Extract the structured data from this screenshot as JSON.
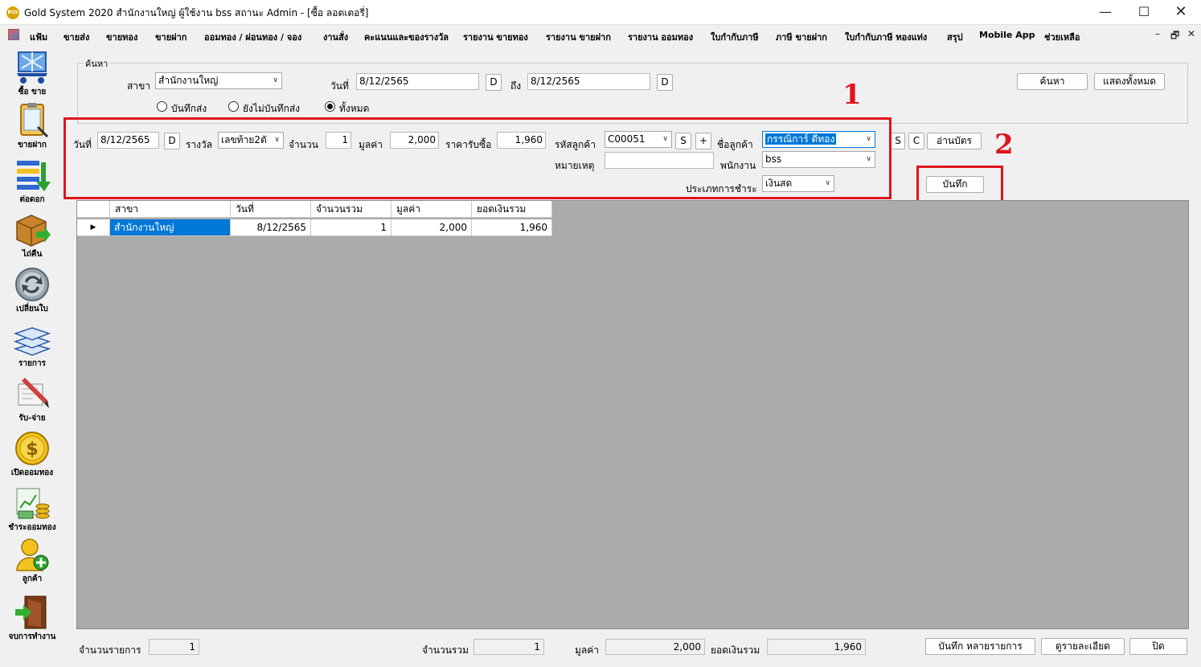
{
  "window": {
    "icon_text": "BSS",
    "title": "Gold System 2020  สำนักงานใหญ่ ผู้ใช้งาน bss สถานะ Admin - [ซื้อ ลอตเตอรี่]",
    "min": "—",
    "max": "☐",
    "close": "✕"
  },
  "menu": {
    "items": [
      "แฟ้ม",
      "ขายส่ง",
      "ขายทอง",
      "ขายฝาก",
      "ออมทอง / ผ่อนทอง / จอง",
      "งานสั่ง",
      "คะแนนและของรางวัล",
      "รายงาน ขายทอง",
      "รายงาน ขายฝาก",
      "รายงาน ออมทอง",
      "ใบกำกับภาษี",
      "ภาษี ขายฝาก",
      "ใบกำกับภาษี ทองแท่ง",
      "สรุป",
      "Mobile App",
      "ช่วยเหลือ"
    ],
    "mdi": [
      "–",
      "🗗",
      "✕"
    ]
  },
  "sidebar": {
    "items": [
      {
        "label": "ซื้อ ขาย",
        "icon": "cart-icon"
      },
      {
        "label": "ขายฝาก",
        "icon": "clipboard-icon"
      },
      {
        "label": "ต่อดอก",
        "icon": "arrows-icon"
      },
      {
        "label": "ไถ่คืน",
        "icon": "box-icon"
      },
      {
        "label": "เปลี่ยนใบ",
        "icon": "refresh-icon"
      },
      {
        "label": "รายการ",
        "icon": "layers-icon"
      },
      {
        "label": "รับ-จ่าย",
        "icon": "pen-icon"
      },
      {
        "label": "เปิดออมทอง",
        "icon": "coin-icon"
      },
      {
        "label": "ชำระออมทอง",
        "icon": "money-icon"
      },
      {
        "label": "ลูกค้า",
        "icon": "user-add-icon"
      },
      {
        "label": "จบการทำงาน",
        "icon": "exit-icon"
      }
    ]
  },
  "search": {
    "legend": "ค้นหา",
    "branch_label": "สาขา",
    "branch_value": "สำนักงานใหญ่",
    "date_label": "วันที่",
    "date_from": "8/12/2565",
    "d_button": "D",
    "to_label": "ถึง",
    "date_to": "8/12/2565",
    "search_button": "ค้นหา",
    "show_all_button": "แสดงทั้งหมด",
    "radio_saved": "บันทึกส่ง",
    "radio_unsaved": "ยังไม่บันทึกส่ง",
    "radio_all": "ทั้งหมด"
  },
  "form": {
    "date_label": "วันที่",
    "date_value": "8/12/2565",
    "d_button": "D",
    "prize_label": "รางวัล",
    "prize_value": "เลขท้าย2ตั",
    "qty_label": "จำนวน",
    "qty_value": "1",
    "value_label": "มูลค่า",
    "value_value": "2,000",
    "buy_price_label": "ราคารับซื้อ",
    "buy_price_value": "1,960",
    "cust_code_label": "รหัสลูกค้า",
    "cust_code_value": "C00051",
    "s_button": "S",
    "plus_button": "+",
    "cust_name_label": "ชื่อลูกค้า",
    "cust_name_value": "กรรณิการ์ ดีทอง",
    "s2_button": "S",
    "c_button": "C",
    "read_card_button": "อ่านบัตร",
    "note_label": "หมายเหตุ",
    "note_value": "",
    "staff_label": "พนักงาน",
    "staff_value": "bss",
    "pay_type_label": "ประเภทการชำระ",
    "pay_type_value": "เงินสด",
    "save_button": "บันทึก"
  },
  "annotations": {
    "one": "1",
    "two": "2"
  },
  "grid": {
    "columns": [
      "สาขา",
      "วันที่",
      "จำนวนรวม",
      "มูลค่า",
      "ยอดเงินรวม"
    ],
    "rows": [
      {
        "branch": "สำนักงานใหญ่",
        "date": "8/12/2565",
        "qty": "1",
        "value": "2,000",
        "total": "1,960"
      }
    ]
  },
  "footer": {
    "count_label": "จำนวนรายการ",
    "count_value": "1",
    "qty_label": "จำนวนรวม",
    "qty_value": "1",
    "value_label": "มูลค่า",
    "value_value": "2,000",
    "total_label": "ยอดเงินรวม",
    "total_value": "1,960",
    "save_many_button": "บันทึก หลายรายการ",
    "details_button": "ดูรายละเอียด",
    "close_button": "ปิด"
  },
  "colors": {
    "annotation_red": "#e0141e",
    "selection_blue": "#0078d7"
  }
}
